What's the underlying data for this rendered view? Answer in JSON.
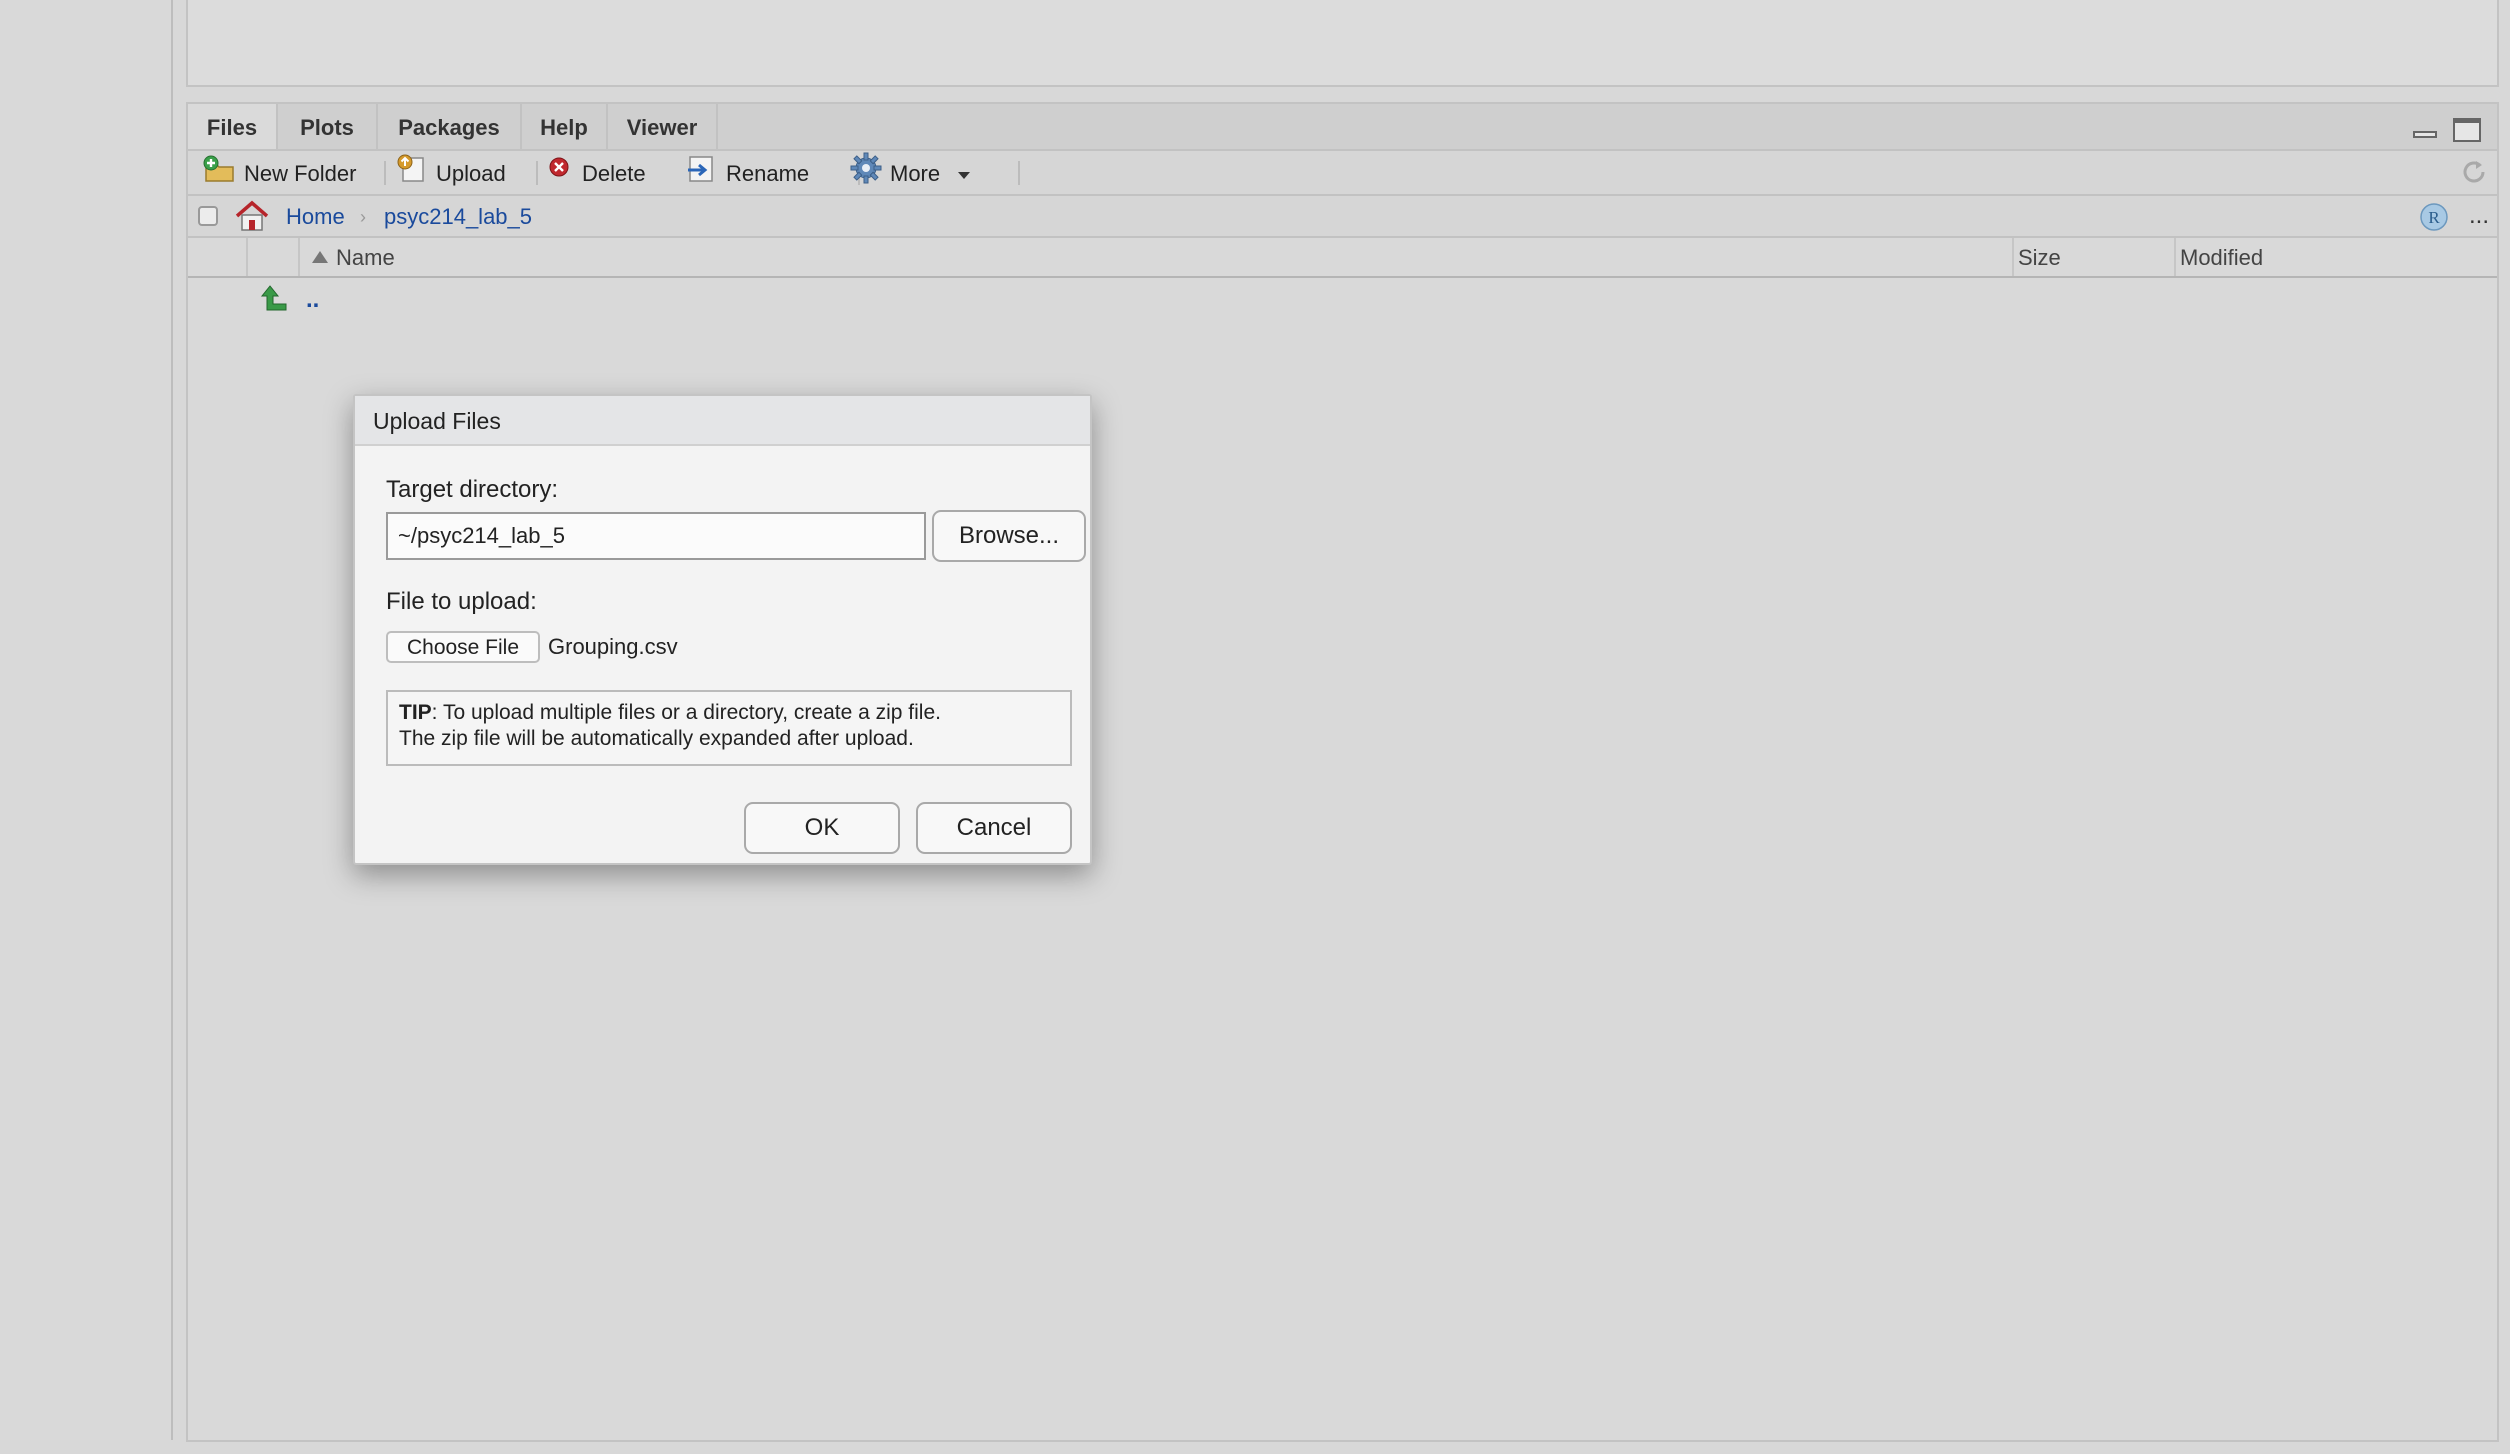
{
  "tabs": [
    {
      "label": "Files",
      "active": true
    },
    {
      "label": "Plots",
      "active": false
    },
    {
      "label": "Packages",
      "active": false
    },
    {
      "label": "Help",
      "active": false
    },
    {
      "label": "Viewer",
      "active": false
    }
  ],
  "toolbar": {
    "new_folder": "New Folder",
    "upload": "Upload",
    "delete": "Delete",
    "rename": "Rename",
    "more": "More"
  },
  "breadcrumb": {
    "home": "Home",
    "folder": "psyc214_lab_5",
    "more": "..."
  },
  "table": {
    "columns": {
      "name": "Name",
      "size": "Size",
      "modified": "Modified"
    },
    "rows": [
      {
        "name": ".."
      }
    ]
  },
  "dialog": {
    "title": "Upload Files",
    "target_label": "Target directory:",
    "target_value": "~/psyc214_lab_5",
    "browse": "Browse...",
    "file_label": "File to upload:",
    "choose_file": "Choose File",
    "chosen_file": "Grouping.csv",
    "tip_bold": "TIP",
    "tip_line1": ": To upload multiple files or a directory, create a zip file.",
    "tip_line2": "The zip file will be automatically expanded after upload.",
    "ok": "OK",
    "cancel": "Cancel"
  },
  "icons": {
    "new_folder": "new-folder-icon",
    "upload": "upload-icon",
    "delete": "delete-icon",
    "rename": "rename-icon",
    "more": "gear-icon",
    "home": "home-icon",
    "parent": "up-arrow-icon",
    "refresh": "refresh-icon",
    "project": "r-project-icon"
  },
  "colors": {
    "link": "#1a4a9c",
    "pane_bg": "#d9d9d9",
    "dialog_bg": "#f3f3f3",
    "delete_red": "#c0282e",
    "parent_green": "#3a9a48"
  }
}
